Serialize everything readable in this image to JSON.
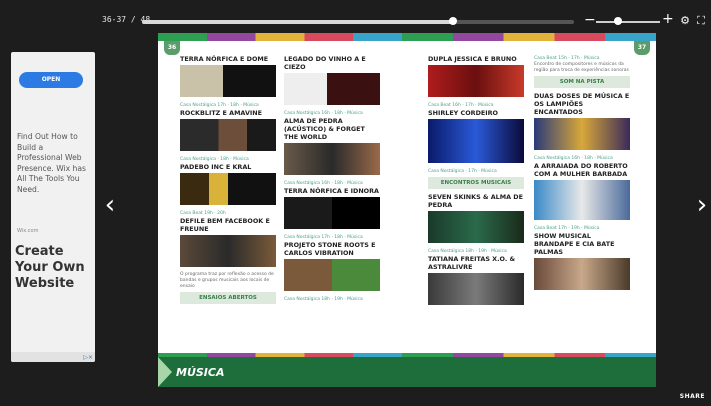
{
  "toolbar": {
    "page_indicator": "36-37 / 48",
    "progress": 0.72,
    "zoom_level": 0.35,
    "icons": [
      "zoom-out-icon",
      "zoom-in-icon",
      "settings-icon",
      "fullscreen-icon"
    ]
  },
  "ad": {
    "open_label": "OPEN",
    "body": "Find Out How to Build a Professional Web Presence. Wix has All The Tools You Need.",
    "brand": "Wix.com",
    "headline": "Create Your Own Website",
    "choice_label": "▷×"
  },
  "nav": {
    "prev": "‹",
    "next": "›"
  },
  "pages": {
    "left_number": "36",
    "right_number": "37",
    "section": "MÚSICA",
    "share": "SHARE"
  },
  "left_col1": {
    "a1_title": "TERRA NÓRFICA E DOME",
    "a1_meta": "Casa Nostálgica 17h · 18h · Música",
    "a2_title": "ROCKBLITZ E AMAVINE",
    "a2_meta": "Casa Nostálgica · 18h · Música",
    "a3_title": "PADEBO INC E KRAL",
    "a3_meta": "Casa Beat 19h · 20h",
    "a4_title": "DEFILE BEM FACEBOOK E FREUNE",
    "a4_meta": "Casa Nostálgica · 20h",
    "tag": "ENSAIOS ABERTOS",
    "text": "O programa traz por reflexão o acesso de bandas e grupos musicais aos locais de ensaio"
  },
  "left_col2": {
    "a1_title": "LEGADO DO VINHO A E CIEZO",
    "a1_meta": "Casa Nostálgica 16h · 18h · Música",
    "a2_title": "ALMA DE PEDRA (ACÚSTICO) & FORGET THE WORLD",
    "a2_meta": "Casa Nostálgica 16h · 18h · Música",
    "a3_title": "TERRA NÓRFICA E IDNORA",
    "a3_meta": "Casa Nostálgica 17h · 18h · Música",
    "a4_title": "PROJETO STONE ROOTS E CARLOS VIBRATION",
    "a4_meta": "Casa Nostálgica 18h · 19h · Música"
  },
  "right_col1": {
    "a1_title": "DUPLA JESSICA E BRUNO",
    "a1_meta": "Casa Beat 16h · 17h · Música",
    "a2_title": "SHIRLEY CORDEIRO",
    "a2_meta": "Casa Nostálgica · 17h · Música",
    "tag": "ENCONTROS MUSICAIS",
    "a3_title": "SEVEN SKINKS & ALMA DE PEDRA",
    "a3_meta": "Casa Nostálgica 18h · 19h · Música",
    "a4_title": "TATIANA FREITAS X.O. & ASTRALIVRE",
    "a4_meta": "Casa Nostálgica 19h · 20h · Música"
  },
  "right_col2": {
    "a1_meta": "Casa Beat 15h · 17h · Música",
    "a1_text": "Encontro de compositores e músicos da região para troca de experiências sonoras",
    "tag": "SOM NA PISTA",
    "a2_title": "DUAS DOSES DE MÚSICA E OS LAMPIÕES ENCANTADOS",
    "a2_meta": "Casa Nostálgica 16h · 18h · Música",
    "a3_title": "A ARRAIADA DO ROBERTO COM A MULHER BARBADA",
    "a3_meta": "Casa Beat 17h · 19h · Música",
    "a4_title": "SHOW MUSICAL BRANDAPE E CIA BATE PALMAS",
    "a4_meta": "Casa Nostálgica · 19h · Música"
  },
  "colors": {
    "band": "#1e6e3c",
    "meta": "#4aa08c",
    "tag_bg": "#dde9dc",
    "ad_button": "#2c7be5"
  }
}
